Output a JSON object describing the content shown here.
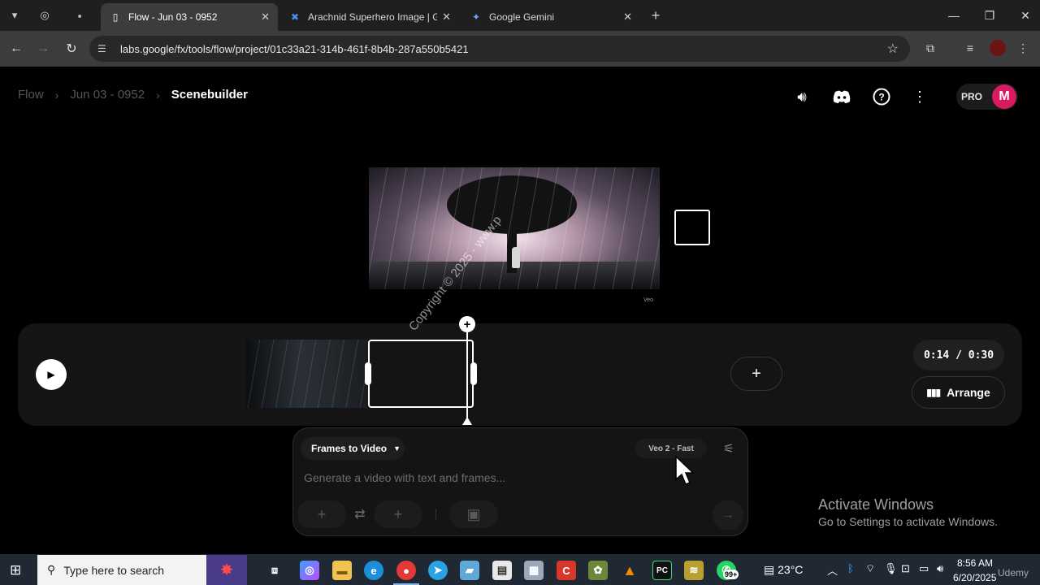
{
  "browser": {
    "tabs": [
      {
        "title": "Flow - Jun 03 - 0952",
        "active": true
      },
      {
        "title": "Arachnid Superhero Image | Go",
        "active": false
      },
      {
        "title": "Google Gemini",
        "active": false
      }
    ],
    "url": "labs.google/fx/tools/flow/project/01c33a21-314b-461f-8b4b-287a550b5421"
  },
  "app": {
    "breadcrumb": [
      "Flow",
      "Jun 03 - 0952"
    ],
    "current": "Scenebuilder",
    "pro_label": "PRO",
    "avatar_initial": "M",
    "accent_color": "#d81b60"
  },
  "preview": {
    "veo_mark": "Veo"
  },
  "timeline": {
    "timecode": "0:14 / 0:30",
    "arrange_label": "Arrange"
  },
  "watermark": "Copyright © 2025 - www.p",
  "prompt": {
    "mode_label": "Frames to Video",
    "model_label": "Veo 2 - Fast",
    "placeholder": "Generate a video with text and frames..."
  },
  "windows": {
    "activate_title": "Activate Windows",
    "activate_sub": "Go to Settings to activate Windows."
  },
  "taskbar": {
    "search_placeholder": "Type here to search",
    "weather": "23°C",
    "time": "8:56 AM",
    "date": "6/20/2025",
    "whatsapp_badge": "99+",
    "udemy": "Udemy"
  }
}
